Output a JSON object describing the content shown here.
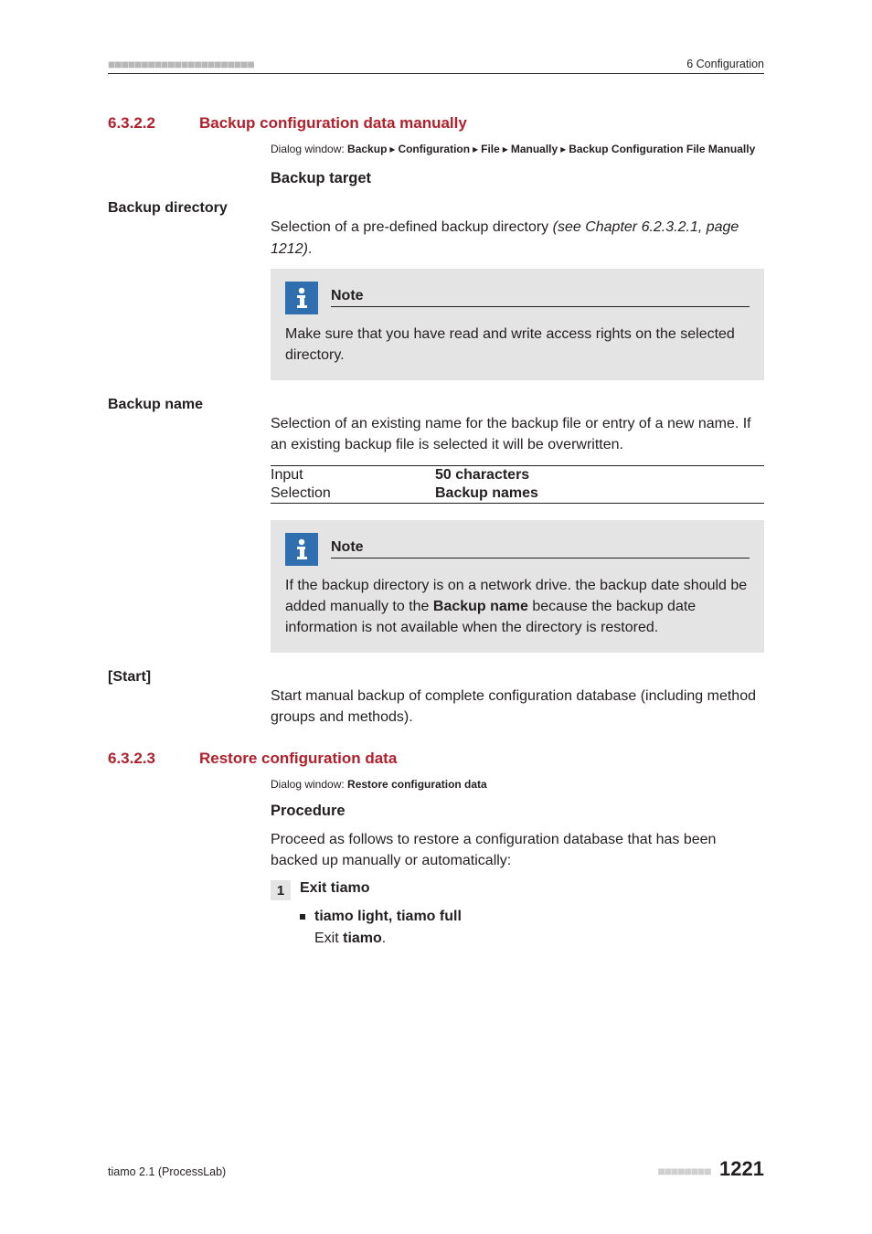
{
  "header": {
    "right": "6 Configuration"
  },
  "sections": {
    "s1": {
      "num": "6.3.2.2",
      "title": "Backup configuration data manually"
    },
    "s2": {
      "num": "6.3.2.3",
      "title": "Restore configuration data"
    }
  },
  "dialog1": {
    "lead": "Dialog window: ",
    "parts": [
      "Backup",
      "Configuration",
      "File",
      "Manually",
      "Backup Configuration File Manually"
    ]
  },
  "dialog2": {
    "lead": "Dialog window: ",
    "bold": "Restore configuration data"
  },
  "backupTarget": "Backup target",
  "backupDirectory": {
    "label": "Backup directory",
    "text_a": "Selection of a pre-defined backup directory ",
    "text_ital": "(see Chapter 6.2.3.2.1, page 1212)",
    "text_b": "."
  },
  "note1": {
    "title": "Note",
    "text": "Make sure that you have read and write access rights on the selected directory."
  },
  "backupName": {
    "label": "Backup name",
    "text": "Selection of an existing name for the backup file or entry of a new name. If an existing backup file is selected it will be overwritten.",
    "rows": [
      {
        "k": "Input",
        "v": "50 characters"
      },
      {
        "k": "Selection",
        "v": "Backup names"
      }
    ]
  },
  "note2": {
    "title": "Note",
    "pre": "If the backup directory is on a network drive. the backup date should be added manually to the ",
    "bold": "Backup name",
    "post": " because the backup date information is not available when the directory is restored."
  },
  "start": {
    "label": "[Start]",
    "text": "Start manual backup of complete configuration database (including method groups and methods)."
  },
  "procedure": {
    "title": "Procedure",
    "text": "Proceed as follows to restore a configuration database that has been backed up manually or automatically:"
  },
  "step1": {
    "num": "1",
    "title": "Exit tiamo",
    "bullet_bold": "tiamo light, tiamo full",
    "line_pre": "Exit ",
    "line_bold": "tiamo",
    "line_post": "."
  },
  "footer": {
    "left": "tiamo 2.1 (ProcessLab)",
    "page": "1221"
  }
}
